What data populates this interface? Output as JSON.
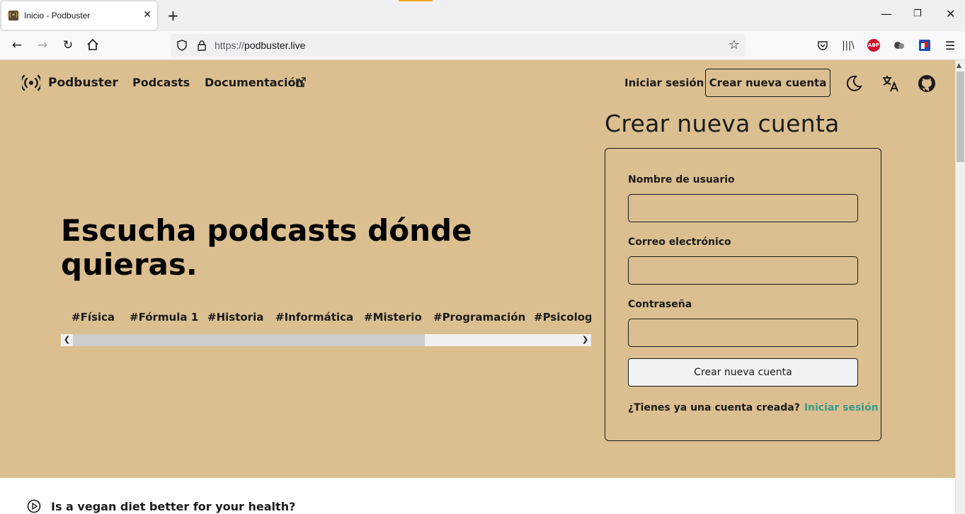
{
  "browser": {
    "tab_title": "Inicio - Podbuster",
    "new_tab": "+",
    "url_prefix": "https://",
    "url_host": "podbuster.live",
    "window": {
      "minimize": "—",
      "restore": "❐",
      "close": "✕"
    }
  },
  "extensions": [
    "pocket-icon",
    "library-icon",
    "adblock-icon",
    "extension-icon",
    "container-icon",
    "menu-icon"
  ],
  "site": {
    "name": "Podbuster",
    "nav": {
      "podcasts": "Podcasts",
      "docs": "Documentación"
    },
    "login": "Iniciar sesión",
    "signup": "Crear nueva cuenta"
  },
  "hero": {
    "title": "Escucha podcasts dónde quieras.",
    "tags": [
      "#Física",
      "#Fórmula 1",
      "#Historia",
      "#Informática",
      "#Misterio",
      "#Programación",
      "#Psicología"
    ]
  },
  "form": {
    "heading": "Crear nueva cuenta",
    "username_label": "Nombre de usuario",
    "email_label": "Correo electrónico",
    "password_label": "Contraseña",
    "submit": "Crear nueva cuenta",
    "footer_text": "¿Tienes ya una cuenta creada?",
    "footer_link": "Iniciar sesión"
  },
  "episodes": [
    "Is a vegan diet better for your health?"
  ],
  "colors": {
    "hero_bg": "#dbbf90",
    "link": "#3a9a8a",
    "text": "#1b1b1b"
  }
}
